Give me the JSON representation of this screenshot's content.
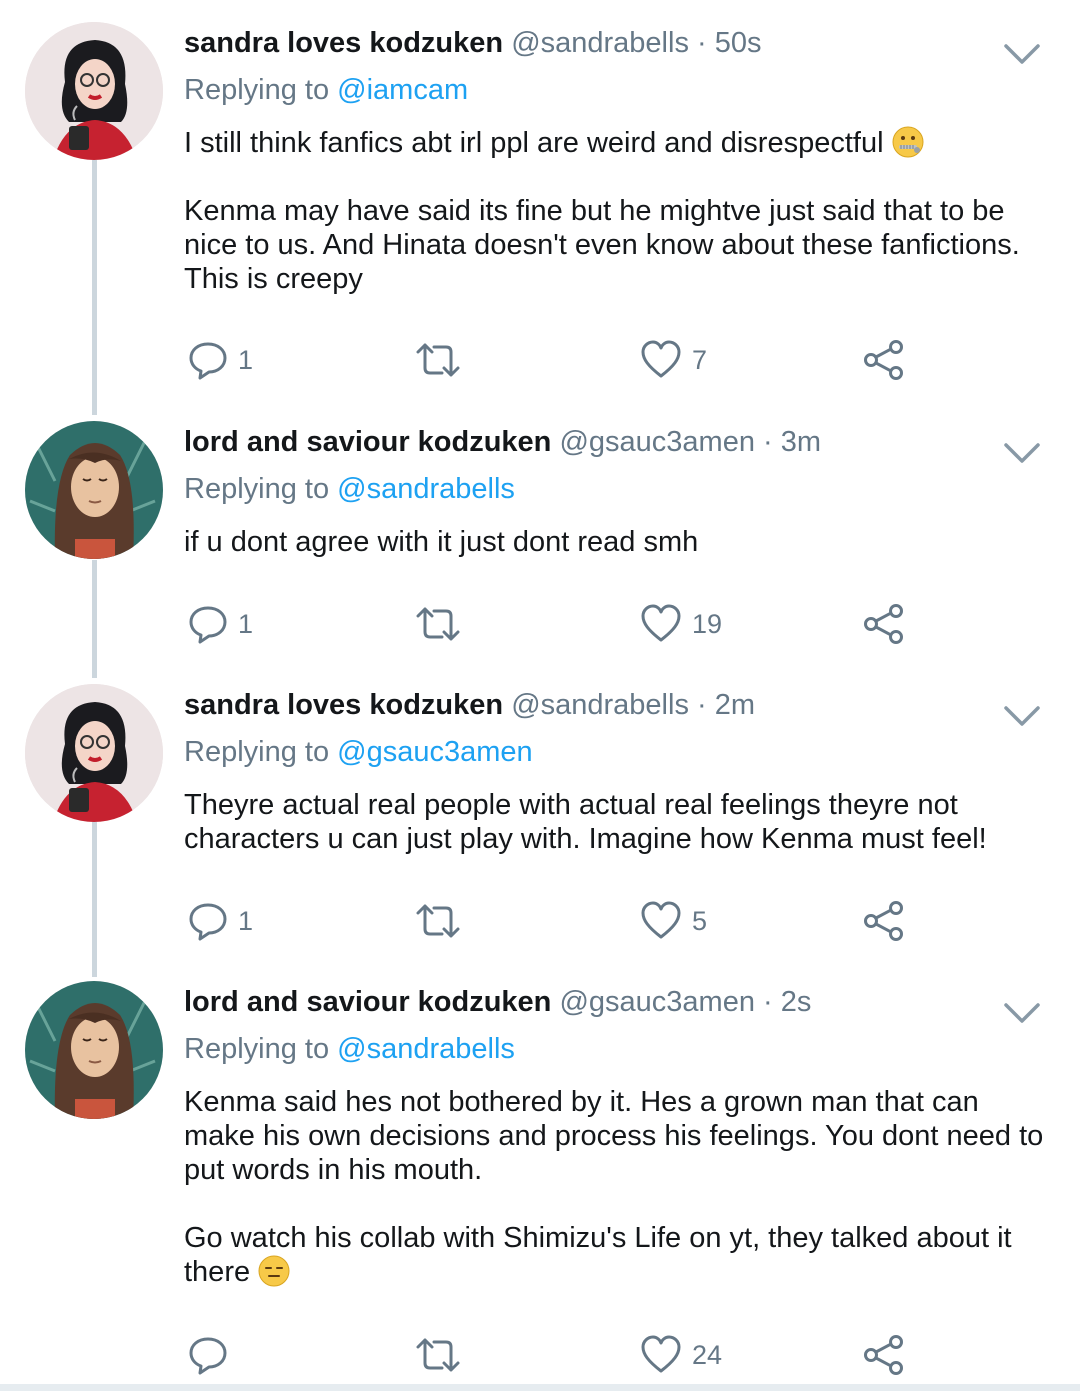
{
  "tweets": [
    {
      "name": "sandra loves kodzuken",
      "handle": "@sandrabells",
      "dot": "·",
      "time": "50s",
      "replying_prefix": "Replying to",
      "replying_to": "@iamcam",
      "paragraphs": [
        "I still think fanfics abt irl ppl are weird and disrespectful",
        "Kenma may have said its fine but he mightve just said that to be nice to us. And Hinata doesn't even know about these fanfictions. This is creepy"
      ],
      "replies": "1",
      "retweets": "",
      "likes": "7",
      "emoji": "zipper-mouth-face"
    },
    {
      "name": "lord and saviour kodzuken",
      "handle": "@gsauc3amen",
      "dot": "·",
      "time": "3m",
      "replying_prefix": "Replying to",
      "replying_to": "@sandrabells",
      "paragraphs": [
        "if u dont agree with it just dont read smh"
      ],
      "replies": "1",
      "retweets": "",
      "likes": "19"
    },
    {
      "name": "sandra loves kodzuken",
      "handle": "@sandrabells",
      "dot": "·",
      "time": "2m",
      "replying_prefix": "Replying to",
      "replying_to": "@gsauc3amen",
      "paragraphs": [
        "Theyre actual real people with actual real feelings theyre not characters u can just play with. Imagine how Kenma must feel!"
      ],
      "replies": "1",
      "retweets": "",
      "likes": "5"
    },
    {
      "name": "lord and saviour kodzuken",
      "handle": "@gsauc3amen",
      "dot": "·",
      "time": "2s",
      "replying_prefix": "Replying to",
      "replying_to": "@sandrabells",
      "paragraphs": [
        "Kenma said hes not bothered by it. Hes a grown man that can make his own decisions and process his feelings. You dont need to put words in his mouth.",
        "Go watch his collab with Shimizu's Life on yt,  they talked about it there"
      ],
      "replies": "",
      "retweets": "",
      "likes": "24",
      "emoji": "expressionless-face"
    }
  ],
  "icons": {
    "reply": "reply-icon",
    "retweet": "retweet-icon",
    "like": "heart-icon",
    "share": "share-icon",
    "menu": "chevron-down-icon"
  },
  "colors": {
    "link": "#1da1f2",
    "muted": "#657786",
    "text": "#14171a",
    "thread": "#ccd6dd"
  }
}
